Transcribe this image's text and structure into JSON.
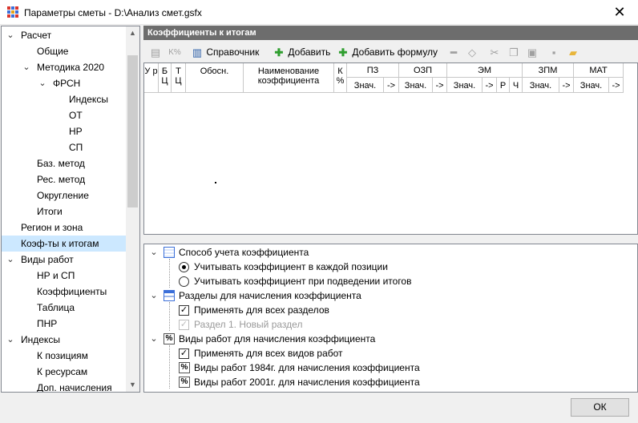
{
  "window": {
    "title": "Параметры сметы - D:\\Анализ смет.gsfx",
    "close_label": "✕"
  },
  "tree": {
    "items": [
      {
        "label": "Расчет",
        "expander": "⌄"
      },
      {
        "label": "Общие",
        "expander": ""
      },
      {
        "label": "Методика 2020",
        "expander": "⌄"
      },
      {
        "label": "ФРСН",
        "expander": "⌄"
      },
      {
        "label": "Индексы",
        "expander": ""
      },
      {
        "label": "ОТ",
        "expander": ""
      },
      {
        "label": "НР",
        "expander": ""
      },
      {
        "label": "СП",
        "expander": ""
      },
      {
        "label": "Баз. метод",
        "expander": ""
      },
      {
        "label": "Рес. метод",
        "expander": ""
      },
      {
        "label": "Округление",
        "expander": ""
      },
      {
        "label": "Итоги",
        "expander": ""
      },
      {
        "label": "Регион и зона",
        "expander": ""
      },
      {
        "label": "Коэф-ты к итогам",
        "expander": "",
        "selected": true
      },
      {
        "label": "Виды работ",
        "expander": "⌄"
      },
      {
        "label": "НР и СП",
        "expander": ""
      },
      {
        "label": "Коэффициенты",
        "expander": ""
      },
      {
        "label": "Таблица",
        "expander": ""
      },
      {
        "label": "ПНР",
        "expander": ""
      },
      {
        "label": "Индексы",
        "expander": "⌄"
      },
      {
        "label": "К позициям",
        "expander": ""
      },
      {
        "label": "К ресурсам",
        "expander": ""
      },
      {
        "label": "Доп. начисления",
        "expander": ""
      }
    ]
  },
  "panel": {
    "title": "Коэффициенты к итогам"
  },
  "toolbar": {
    "reference_label": "Справочник",
    "add_label": "Добавить",
    "add_formula_label": "Добавить формулу"
  },
  "grid": {
    "headers": {
      "u": "У р",
      "b": "Б Ц",
      "t": "Т Ц",
      "obosn": "Обосн.",
      "name": "Наименование коэффициента",
      "kpct": "К %",
      "pz": "ПЗ",
      "ozp": "ОЗП",
      "em": "ЭМ",
      "zpm": "ЗПМ",
      "mat": "МАТ",
      "val": "Знач.",
      "arrow": "->",
      "r": "Р",
      "ch": "Ч"
    }
  },
  "options": {
    "group1": {
      "label": "Способ учета коэффициента",
      "radio1": "Учитывать коэффициент в каждой позиции",
      "radio2": "Учитывать коэффициент при подведении итогов",
      "selected": 1
    },
    "group2": {
      "label": "Разделы для начисления коэффициента",
      "check1": "Применять для всех разделов",
      "check2": "Раздел 1. Новый раздел"
    },
    "group3": {
      "label": "Виды работ для начисления коэффициента",
      "check1": "Применять для всех видов работ",
      "item1": "Виды работ 1984г. для начисления коэффициента",
      "item2": "Виды работ 2001г. для начисления коэффициента"
    }
  },
  "footer": {
    "ok_label": "ОК"
  },
  "colors": {
    "selection": "#cce8ff",
    "panel_header": "#6d6d6d",
    "add_green": "#2e9e2e",
    "folder": "#e8b53a"
  }
}
